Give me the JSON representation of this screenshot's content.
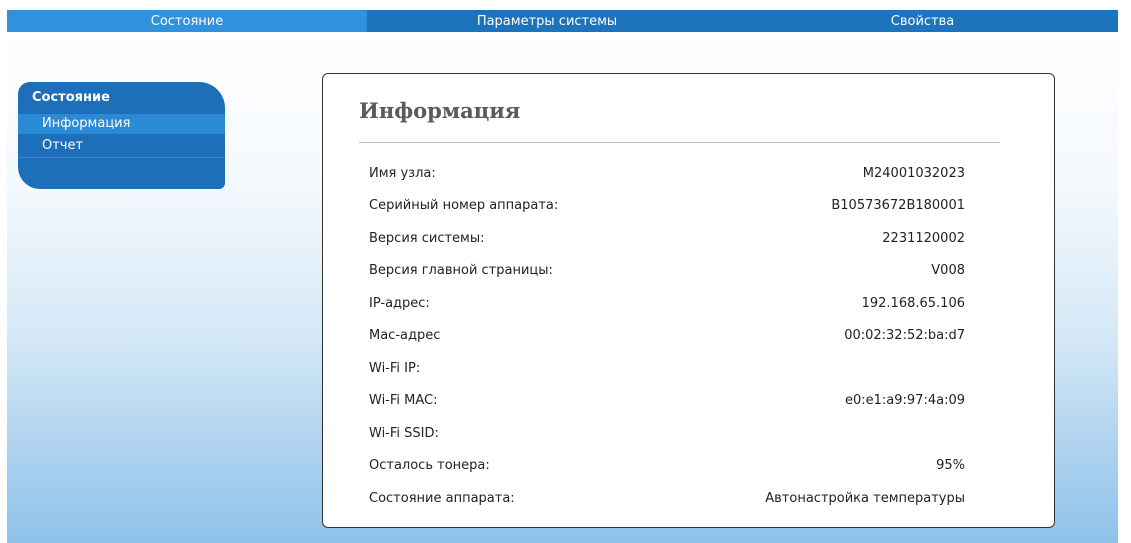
{
  "topnav": {
    "tabs": [
      {
        "label": "Состояние"
      },
      {
        "label": "Параметры системы"
      },
      {
        "label": "Свойства"
      }
    ]
  },
  "sidebar": {
    "title": "Состояние",
    "items": [
      {
        "label": "Информация"
      },
      {
        "label": "Отчет"
      }
    ]
  },
  "panel": {
    "title": "Информация",
    "rows": [
      {
        "label": "Имя узла:",
        "value": "M24001032023"
      },
      {
        "label": "Серийный номер аппарата:",
        "value": "B10573672B180001"
      },
      {
        "label": "Версия системы:",
        "value": "2231120002"
      },
      {
        "label": "Версия главной страницы:",
        "value": "V008"
      },
      {
        "label": "IP-адрес:",
        "value": "192.168.65.106"
      },
      {
        "label": "Mac-адрес",
        "value": "00:02:32:52:ba:d7"
      },
      {
        "label": "Wi-Fi IP:",
        "value": ""
      },
      {
        "label": "Wi-Fi MAC:",
        "value": "e0:e1:a9:97:4a:09"
      },
      {
        "label": "Wi-Fi SSID:",
        "value": ""
      },
      {
        "label": "Осталось тонера:",
        "value": "95%"
      },
      {
        "label": "Состояние аппарата:",
        "value": "Автонастройка температуры"
      }
    ]
  }
}
